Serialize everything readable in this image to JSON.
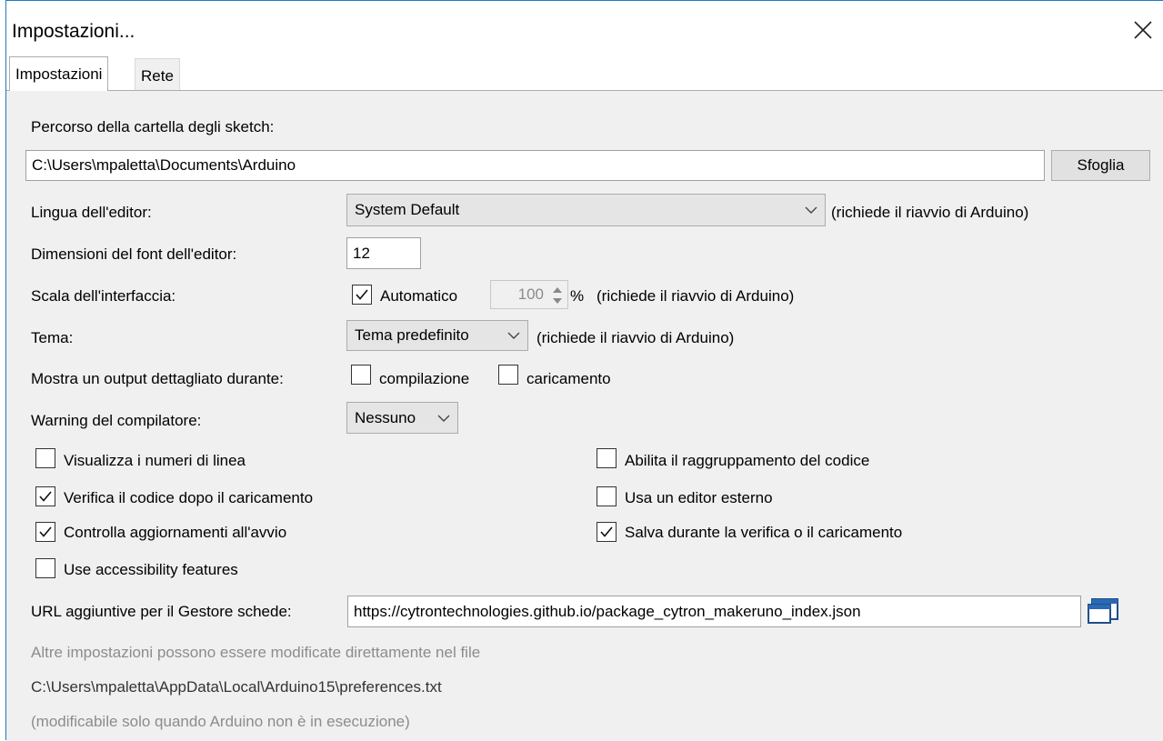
{
  "window": {
    "title": "Impostazioni..."
  },
  "tabs": [
    {
      "label": "Impostazioni",
      "active": true
    },
    {
      "label": "Rete",
      "active": false
    }
  ],
  "sketchbook": {
    "label": "Percorso della cartella degli sketch:",
    "value": "C:\\Users\\mpaletta\\Documents\\Arduino",
    "browse_label": "Sfoglia"
  },
  "language": {
    "label": "Lingua dell'editor:",
    "selected": "System Default",
    "note": "(richiede il riavvio di Arduino)"
  },
  "font_size": {
    "label": "Dimensioni del font dell'editor:",
    "value": "12"
  },
  "scale": {
    "label": "Scala dell'interfaccia:",
    "auto_label": "Automatico",
    "auto_checked": true,
    "value": "100",
    "percent": "%",
    "note": "(richiede il riavvio di Arduino)"
  },
  "theme": {
    "label": "Tema:",
    "selected": "Tema predefinito",
    "note": "(richiede il riavvio di Arduino)"
  },
  "verbose": {
    "label": "Mostra un output dettagliato durante:",
    "compile_label": "compilazione",
    "compile_checked": false,
    "upload_label": "caricamento",
    "upload_checked": false
  },
  "warnings": {
    "label": "Warning del compilatore:",
    "selected": "Nessuno"
  },
  "options": {
    "line_numbers": {
      "label": "Visualizza i numeri di linea",
      "checked": false
    },
    "verify_upload": {
      "label": "Verifica il codice dopo il caricamento",
      "checked": true
    },
    "check_updates": {
      "label": "Controlla aggiornamenti all'avvio",
      "checked": true
    },
    "accessibility": {
      "label": "Use accessibility features",
      "checked": false
    },
    "code_folding": {
      "label": "Abilita il raggruppamento del codice",
      "checked": false
    },
    "external_editor": {
      "label": "Usa un editor esterno",
      "checked": false
    },
    "save_verify": {
      "label": "Salva durante la verifica o il caricamento",
      "checked": true
    }
  },
  "boards_url": {
    "label": "URL aggiuntive per il Gestore schede:",
    "value": "https://cytrontechnologies.github.io/package_cytron_makeruno_index.json"
  },
  "footer": {
    "line1": "Altre impostazioni possono essere modificate direttamente nel file",
    "line2": "C:\\Users\\mpaletta\\AppData\\Local\\Arduino15\\preferences.txt",
    "line3": "(modificabile solo quando Arduino non è in esecuzione)"
  },
  "icons": {
    "close": "close-icon",
    "check": "check-icon",
    "chevron": "chevron-down-icon",
    "window_edit": "window-edit-icon"
  },
  "colors": {
    "accent": "#1c7cc4",
    "panel": "#f0f0f0",
    "hint": "#8c8c8c"
  }
}
